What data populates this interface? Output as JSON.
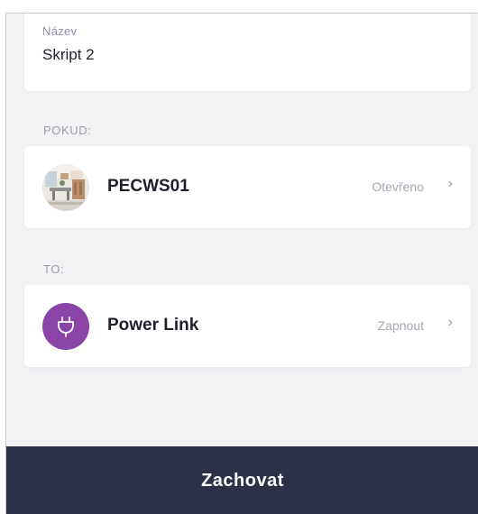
{
  "name_field": {
    "label": "Název",
    "value": "Skript 2"
  },
  "condition_section": {
    "label": "POKUD:",
    "device": {
      "name": "PECWS01",
      "status": "Otevřeno",
      "icon": "room-photo-icon"
    }
  },
  "action_section": {
    "label": "TO:",
    "device": {
      "name": "Power Link",
      "status": "Zapnout",
      "icon": "plug-icon"
    }
  },
  "chevron": "›",
  "save_button": {
    "label": "Zachovat"
  },
  "colors": {
    "background": "#f2f2f5",
    "card": "#ffffff",
    "accent_purple": "#8a44a8",
    "bottom_bar": "#2c3149"
  }
}
